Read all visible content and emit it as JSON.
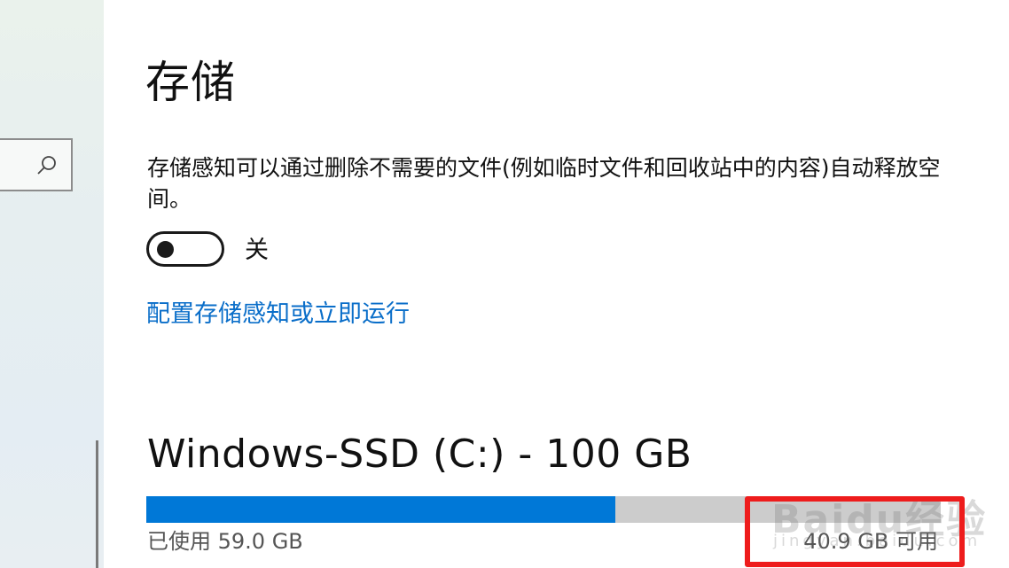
{
  "sidebar": {
    "search_icon": "search-icon"
  },
  "storage": {
    "title": "存储",
    "description": "存储感知可以通过删除不需要的文件(例如临时文件和回收站中的内容)自动释放空间。",
    "toggle": {
      "state": "off",
      "label": "关"
    },
    "config_link": "配置存储感知或立即运行"
  },
  "drive": {
    "title": "Windows-SSD (C:) - 100 GB",
    "used_fraction": 0.59,
    "used_label": "已使用 59.0 GB",
    "free_label": "40.9 GB 可用"
  },
  "watermark": {
    "text": "Baidu经验",
    "sub": "jingyan.baidu.com"
  },
  "colors": {
    "accent": "#0078d7",
    "link": "#0a6ec9",
    "highlight": "#ee1c1c"
  }
}
